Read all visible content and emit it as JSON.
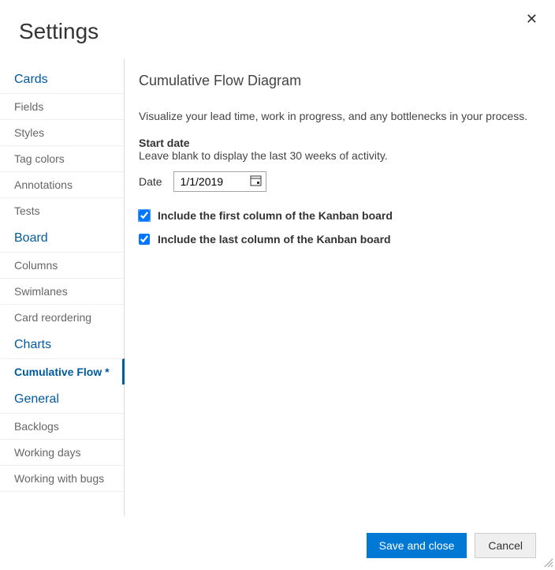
{
  "dialog": {
    "title": "Settings"
  },
  "sidebar": {
    "sections": [
      {
        "header": "Cards",
        "items": [
          "Fields",
          "Styles",
          "Tag colors",
          "Annotations",
          "Tests"
        ]
      },
      {
        "header": "Board",
        "items": [
          "Columns",
          "Swimlanes",
          "Card reordering"
        ]
      },
      {
        "header": "Charts",
        "items": [
          "Cumulative Flow *"
        ]
      },
      {
        "header": "General",
        "items": [
          "Backlogs",
          "Working days",
          "Working with bugs"
        ]
      }
    ]
  },
  "content": {
    "panel_title": "Cumulative Flow Diagram",
    "description": "Visualize your lead time, work in progress, and any bottlenecks in your process.",
    "start_date_label": "Start date",
    "start_date_hint": "Leave blank to display the last 30 weeks of activity.",
    "date_label": "Date",
    "date_value": "1/1/2019",
    "cb_first_label": "Include the first column of the Kanban board",
    "cb_last_label": "Include the last column of the Kanban board"
  },
  "footer": {
    "save_label": "Save and close",
    "cancel_label": "Cancel"
  }
}
